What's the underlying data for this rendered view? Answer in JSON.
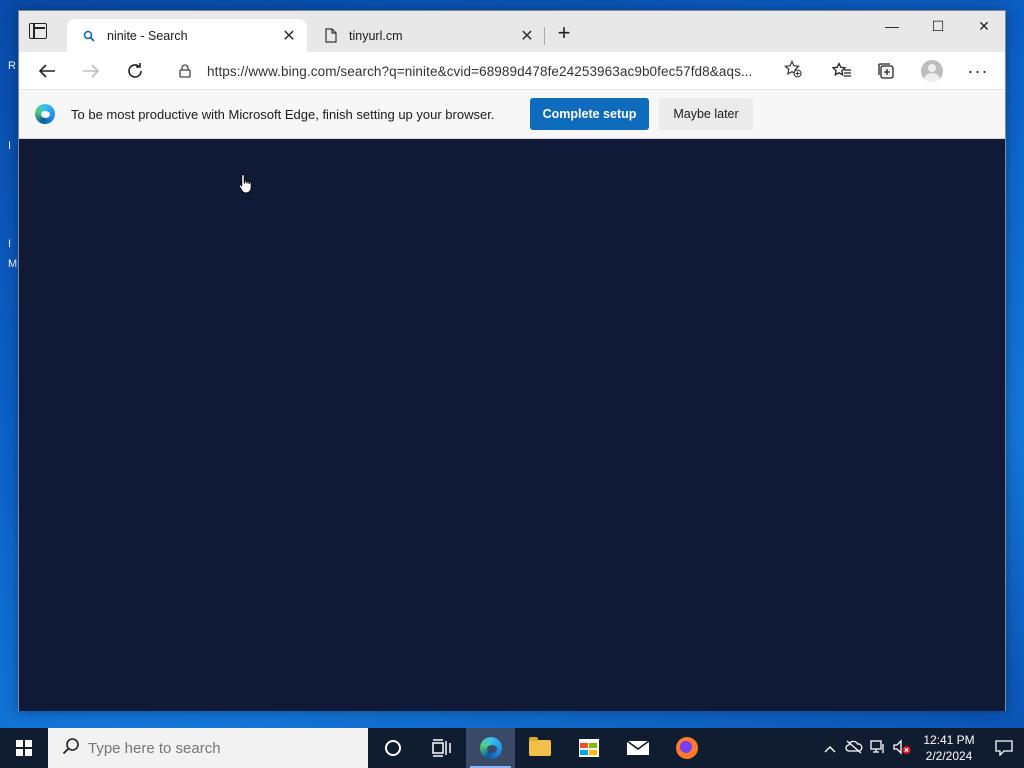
{
  "browser": {
    "tabs": [
      {
        "title": "ninite - Search",
        "icon": "search-icon",
        "active": true
      },
      {
        "title": "tinyurl.cm",
        "icon": "page-icon",
        "active": false
      }
    ],
    "window_controls": {
      "minimize": "—",
      "maximize": "☐",
      "close": "✕"
    },
    "address_bar": {
      "url": "https://www.bing.com/search?q=ninite&cvid=68989d478fe24253963ac9b0fec57fd8&aqs..."
    },
    "infobar": {
      "message": "To be most productive with Microsoft Edge, finish setting up your browser.",
      "primary_button": "Complete setup",
      "secondary_button": "Maybe later"
    },
    "content_background": "#101a36"
  },
  "taskbar": {
    "search_placeholder": "Type here to search",
    "clock_time": "12:41 PM",
    "clock_date": "2/2/2024",
    "apps": [
      "cortana-icon",
      "task-view-icon",
      "edge-icon",
      "file-explorer-icon",
      "store-icon",
      "mail-icon",
      "firefox-icon"
    ]
  },
  "colors": {
    "accent_blue": "#0f6cbd",
    "taskbar_bg": "#101c30",
    "desktop_blue": "#0b62c8"
  }
}
